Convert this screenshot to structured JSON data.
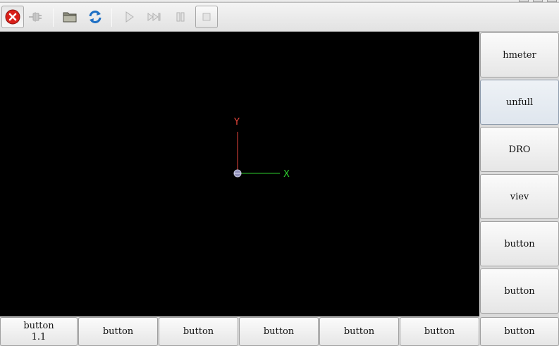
{
  "toolbar": {
    "buttons": [
      {
        "icon": "estop-icon",
        "state": "active"
      },
      {
        "icon": "power-icon",
        "state": "disabled"
      },
      {
        "icon": "open-folder-icon",
        "state": "enabled"
      },
      {
        "icon": "reload-icon",
        "state": "enabled"
      },
      {
        "icon": "run-icon",
        "state": "disabled"
      },
      {
        "icon": "step-icon",
        "state": "disabled"
      },
      {
        "icon": "pause-icon",
        "state": "disabled"
      },
      {
        "icon": "stop-icon",
        "state": "disabled"
      }
    ]
  },
  "preview": {
    "x_label": "X",
    "y_label": "Y",
    "x_color": "#2ecc2e",
    "y_color": "#e8463c"
  },
  "side_buttons": [
    {
      "label": "hmeter",
      "active": false
    },
    {
      "label": "unfull",
      "active": true
    },
    {
      "label": "DRO",
      "active": false
    },
    {
      "label": "viev",
      "active": false
    },
    {
      "label": "button",
      "active": false
    },
    {
      "label": "button",
      "active": false
    }
  ],
  "bottom_buttons": [
    {
      "line1": "button",
      "line2": "1.1"
    },
    {
      "line1": "button",
      "line2": ""
    },
    {
      "line1": "button",
      "line2": ""
    },
    {
      "line1": "button",
      "line2": ""
    },
    {
      "line1": "button",
      "line2": ""
    },
    {
      "line1": "button",
      "line2": ""
    },
    {
      "line1": "button",
      "line2": ""
    }
  ],
  "colors": {
    "estop": "#d9201a",
    "reload": "#1d6fc4"
  }
}
